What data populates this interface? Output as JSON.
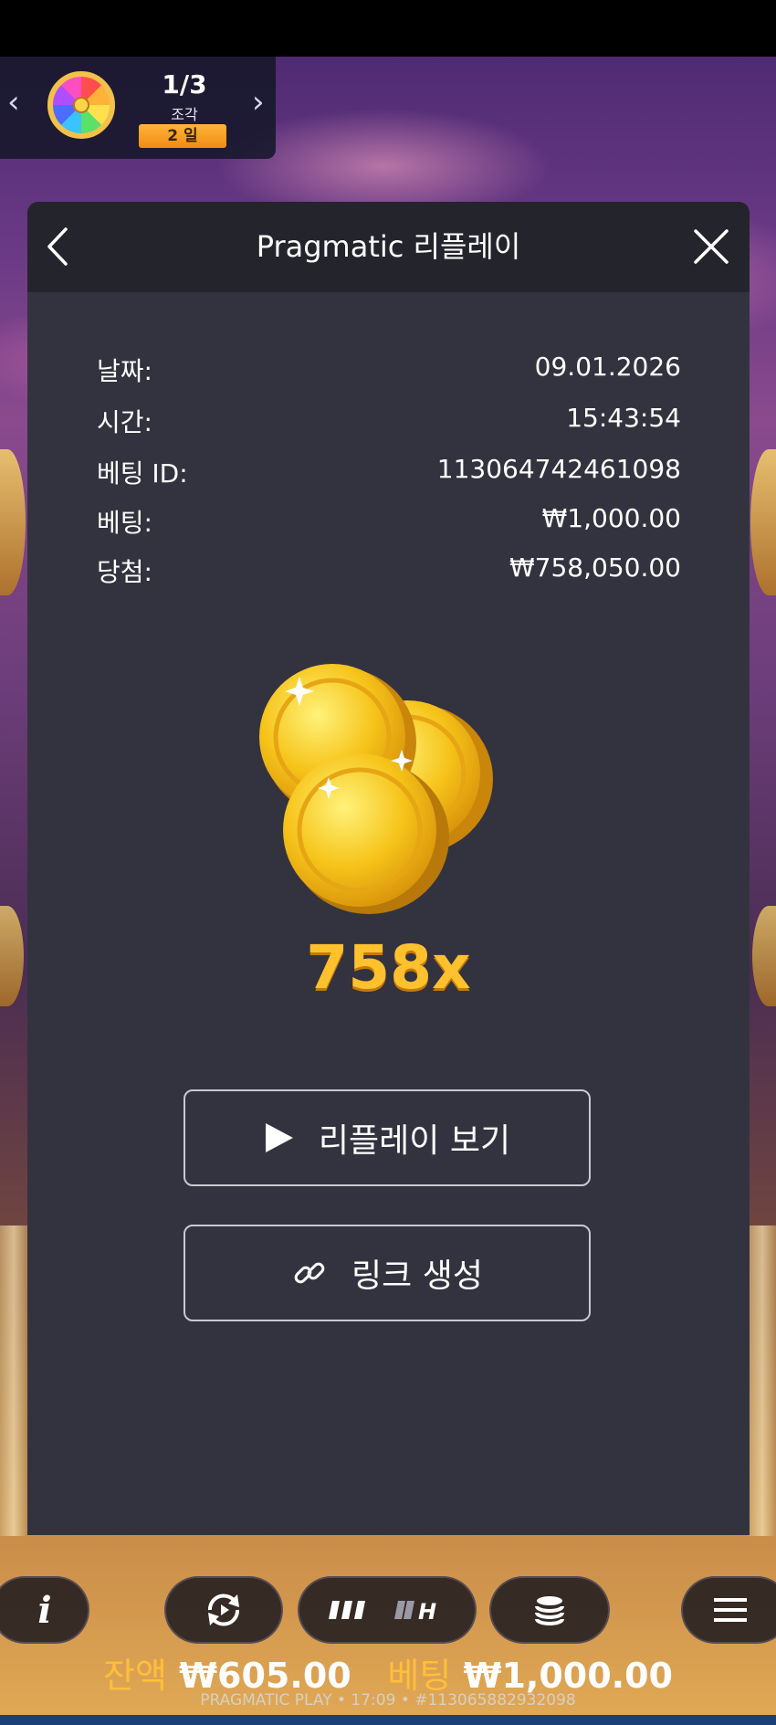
{
  "event_widget": {
    "count": "1/3",
    "label": "조각",
    "days": "2 일"
  },
  "modal": {
    "title": "Pragmatic 리플레이",
    "rows": [
      {
        "key": "날짜:",
        "value": "09.01.2026"
      },
      {
        "key": "시간:",
        "value": "15:43:54"
      },
      {
        "key": "베팅 ID:",
        "value": "113064742461098"
      },
      {
        "key": "베팅:",
        "value": "₩1,000.00"
      },
      {
        "key": "당첨:",
        "value": "₩758,050.00"
      }
    ],
    "multiplier": "758x",
    "watch_replay_label": "리플레이 보기",
    "create_link_label": "링크 생성"
  },
  "bottom_bar": {
    "balance_label": "잔액",
    "balance_value": "₩605.00",
    "bet_label": "베팅",
    "bet_value": "₩1,000.00",
    "footer": "PRAGMATIC PLAY • 17:09 • #113065882932098"
  },
  "icons": [
    "chevron-left-icon",
    "chevron-right-icon",
    "prize-wheel-icon",
    "back-arrow-icon",
    "close-icon",
    "gold-coins-icon",
    "play-icon",
    "link-icon",
    "info-icon",
    "autoplay-icon",
    "turbo-icon",
    "quick-spin-icon",
    "coin-stack-icon",
    "menu-icon"
  ],
  "colors": {
    "accent": "#ffc12e",
    "modal_bg": "#33333f",
    "modal_header_bg": "#24242c",
    "balance_label": "#ffbf3a"
  }
}
